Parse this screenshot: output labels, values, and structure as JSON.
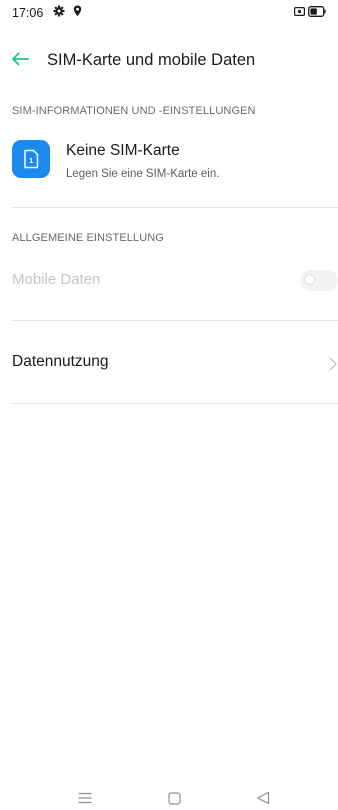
{
  "status_bar": {
    "time": "17:06",
    "icons": [
      "gear-icon",
      "location-pin-icon",
      "screen-record-icon",
      "battery-icon"
    ]
  },
  "header": {
    "title": "SIM-Karte und mobile Daten",
    "back_icon": "arrow-left-icon"
  },
  "sim_section": {
    "header": "SIM-INFORMATIONEN UND -EINSTELLUNGEN",
    "sim_card": {
      "icon": "sim-card-icon",
      "slot_number": "1",
      "title": "Keine SIM-Karte",
      "subtitle": "Legen Sie eine SIM-Karte ein."
    }
  },
  "general_section": {
    "header": "ALLGEMEINE EINSTELLUNG",
    "mobile_data": {
      "label": "Mobile Daten",
      "enabled": false,
      "disabled": true
    },
    "data_usage": {
      "label": "Datennutzung"
    }
  },
  "colors": {
    "accent": "#1ec28b",
    "sim_icon_bg": "#1b8aef"
  },
  "nav_bar": {
    "icons": [
      "menu-icon",
      "home-icon",
      "back-triangle-icon"
    ]
  }
}
